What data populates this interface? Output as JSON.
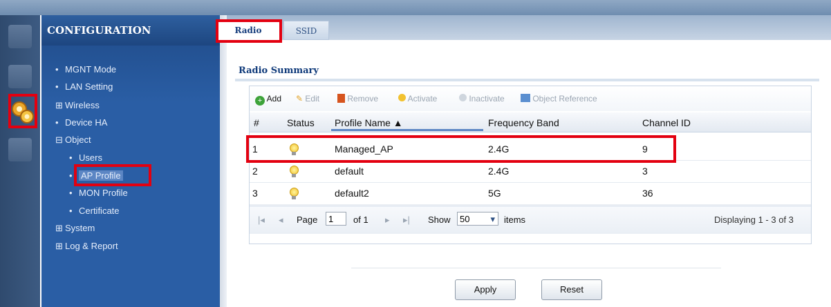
{
  "sidebar": {
    "title": "CONFIGURATION",
    "items": [
      {
        "label": "MGNT Mode",
        "bullet": "•"
      },
      {
        "label": "LAN Setting",
        "bullet": "•"
      },
      {
        "label": "Wireless",
        "bullet": "⊞"
      },
      {
        "label": "Device HA",
        "bullet": "•"
      },
      {
        "label": "Object",
        "bullet": "⊟"
      },
      {
        "label": "Users",
        "bullet": "•"
      },
      {
        "label": "AP Profile",
        "bullet": "•"
      },
      {
        "label": "MON Profile",
        "bullet": "•"
      },
      {
        "label": "Certificate",
        "bullet": "•"
      },
      {
        "label": "System",
        "bullet": "⊞"
      },
      {
        "label": "Log & Report",
        "bullet": "⊞"
      }
    ]
  },
  "tabs": [
    {
      "label": "Radio",
      "active": true
    },
    {
      "label": "SSID",
      "active": false
    }
  ],
  "section": {
    "title": "Radio Summary"
  },
  "toolbar": {
    "add": "Add",
    "edit": "Edit",
    "remove": "Remove",
    "activate": "Activate",
    "inactivate": "Inactivate",
    "object_reference": "Object Reference"
  },
  "table": {
    "columns": [
      "#",
      "Status",
      "Profile Name ▲",
      "Frequency Band",
      "Channel ID"
    ],
    "rows": [
      {
        "num": "1",
        "status": "bulb-icon",
        "profile": "Managed_AP",
        "band": "2.4G",
        "channel": "9"
      },
      {
        "num": "2",
        "status": "bulb-icon",
        "profile": "default",
        "band": "2.4G",
        "channel": "3"
      },
      {
        "num": "3",
        "status": "bulb-icon",
        "profile": "default2",
        "band": "5G",
        "channel": "36"
      }
    ]
  },
  "pager": {
    "page_label": "Page",
    "page_value": "1",
    "of_label": "of 1",
    "show_label": "Show",
    "show_value": "50",
    "items_label": "items",
    "displaying": "Displaying 1 - 3 of 3"
  },
  "buttons": {
    "apply": "Apply",
    "reset": "Reset"
  },
  "colors": {
    "highlight": "#e30010",
    "sidebar": "#2a5ea5"
  }
}
